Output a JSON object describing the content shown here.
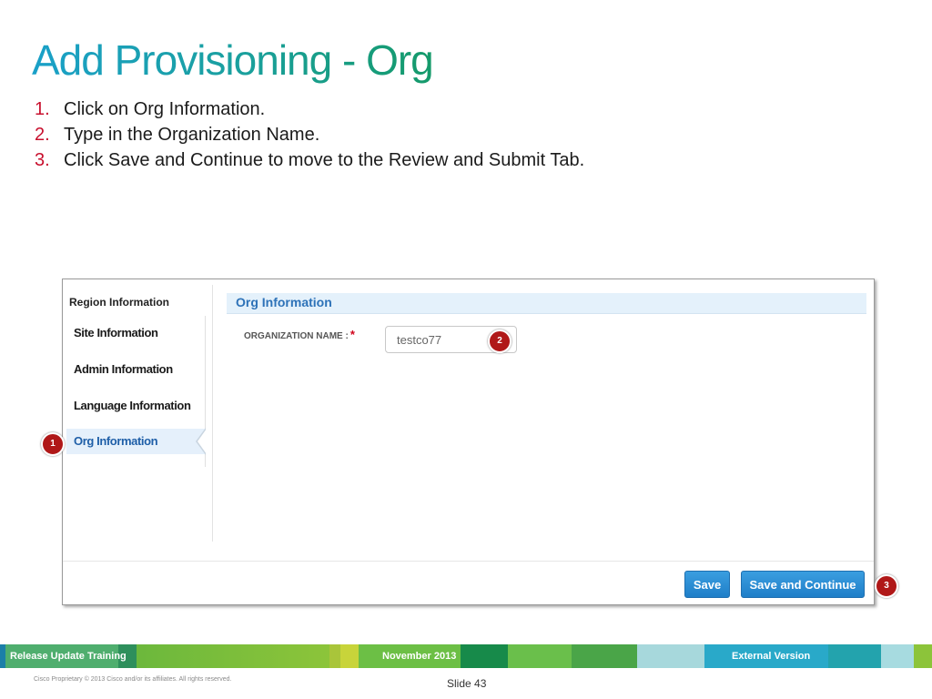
{
  "slide": {
    "title": "Add Provisioning - Org",
    "steps": [
      {
        "num": "1.",
        "text": "Click on Org Information."
      },
      {
        "num": "2.",
        "text": "Type in the Organization Name."
      },
      {
        "num": "3.",
        "text": "Click Save and Continue to move to the Review and Submit Tab."
      }
    ]
  },
  "app": {
    "nav_header": "Region Information",
    "nav_items": [
      {
        "label": "Site Information",
        "active": false
      },
      {
        "label": "Admin Information",
        "active": false
      },
      {
        "label": "Language Information",
        "active": false
      },
      {
        "label": "Org Information",
        "active": true
      }
    ],
    "section_title": "Org Information",
    "org_name_label": "ORGANIZATION NAME :",
    "required_marker": "*",
    "org_name_value": "testco77",
    "save_label": "Save",
    "save_continue_label": "Save and Continue"
  },
  "callouts": [
    "1",
    "2",
    "3"
  ],
  "footer": {
    "left_label": "Release Update Training",
    "center_label": "November 2013",
    "right_label": "External Version",
    "copyright": "Cisco Proprietary © 2013 Cisco and/or its affiliates. All rights reserved.",
    "slide_number": "Slide 43"
  },
  "colors": {
    "accent_red": "#c8102e",
    "link_blue": "#2d72b8",
    "button_blue": "#1f7ec8",
    "callout_red": "#b01818"
  }
}
